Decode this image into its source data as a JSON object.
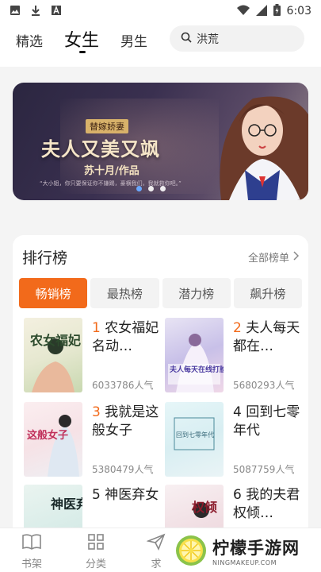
{
  "status_bar": {
    "time": "6:03",
    "icons_left": [
      "image-icon",
      "download-icon",
      "font-icon"
    ],
    "icons_right": [
      "wifi-icon",
      "signal-icon",
      "battery-icon"
    ]
  },
  "top_nav": {
    "tabs": [
      {
        "label": "精选"
      },
      {
        "label": "女生",
        "active": true
      },
      {
        "label": "男生"
      }
    ],
    "search": {
      "value": "洪荒"
    }
  },
  "banner": {
    "tag": "替嫁娇妻",
    "title": "夫人又美又飒",
    "author": "苏十月/作品",
    "quote": "“大小姐，你只要保证你不嫌踢，豪横我们，我就救你吧。”",
    "dots": 3,
    "active_dot": 0
  },
  "ranking": {
    "title": "排行榜",
    "all_link": "全部榜单",
    "tabs": [
      {
        "label": "畅销榜",
        "active": true
      },
      {
        "label": "最热榜"
      },
      {
        "label": "潜力榜"
      },
      {
        "label": "飙升榜"
      }
    ],
    "books": [
      {
        "rank": "1",
        "title": "农女福妃名动…",
        "popularity": "6033786人气",
        "cover_text": "农女福妃"
      },
      {
        "rank": "2",
        "title": "夫人每天都在…",
        "popularity": "5680293人气",
        "cover_text": "夫人每天在线打脸"
      },
      {
        "rank": "3",
        "title": "我就是这般女子",
        "popularity": "5380479人气",
        "cover_text": "这般女子"
      },
      {
        "rank": "4",
        "title": "回到七零年代",
        "popularity": "5087759人气",
        "cover_text": "回到七零年代"
      },
      {
        "rank": "5",
        "title": "神医弃女",
        "popularity": "",
        "cover_text": "神医弃女"
      },
      {
        "rank": "6",
        "title": "我的夫君权倾…",
        "popularity": "",
        "cover_text": "权倾"
      }
    ]
  },
  "bottom_nav": {
    "items": [
      {
        "label": "书架"
      },
      {
        "label": "分类"
      },
      {
        "label": "求"
      }
    ]
  },
  "watermark": {
    "title": "柠檬手游网",
    "url": "NINGMAKEUP.COM"
  },
  "colors": {
    "accent": "#f26a1b",
    "banner_dot_active": "#6aa8ff"
  }
}
